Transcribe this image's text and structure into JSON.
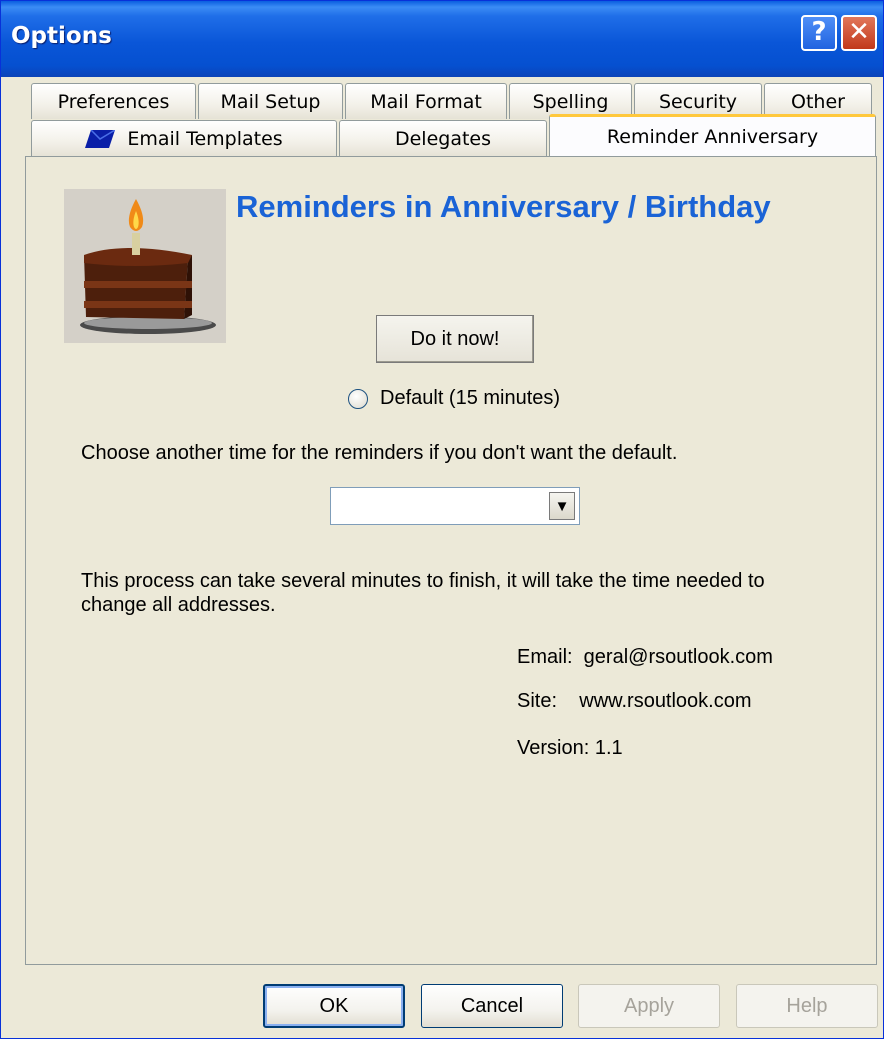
{
  "window": {
    "title": "Options"
  },
  "tabs_row1": [
    {
      "label": "Preferences"
    },
    {
      "label": "Mail Setup"
    },
    {
      "label": "Mail Format"
    },
    {
      "label": "Spelling"
    },
    {
      "label": "Security"
    },
    {
      "label": "Other"
    }
  ],
  "tabs_row2": [
    {
      "label": "Email Templates",
      "icon": "envelope-icon"
    },
    {
      "label": "Delegates"
    },
    {
      "label": "Reminder Anniversary",
      "active": true
    }
  ],
  "panel": {
    "heading": "Reminders in Anniversary / Birthday",
    "image": "birthday-cake-icon",
    "do_it_label": "Do it now!",
    "radio_label": "Default (15 minutes)",
    "instruction": "Choose another time for the reminders if you don't want the default.",
    "combo_value": "",
    "process_text": "This process can take several minutes to finish, it will take the time needed to change all addresses.",
    "email": "Email:  geral@rsoutlook.com",
    "site": "Site:    www.rsoutlook.com",
    "version": "Version: 1.1"
  },
  "buttons": {
    "ok": "OK",
    "cancel": "Cancel",
    "apply": "Apply",
    "help": "Help"
  },
  "colors": {
    "title_bar": "#0a56d8",
    "heading": "#1a63d6",
    "active_tab_accent": "#ffc83c"
  }
}
